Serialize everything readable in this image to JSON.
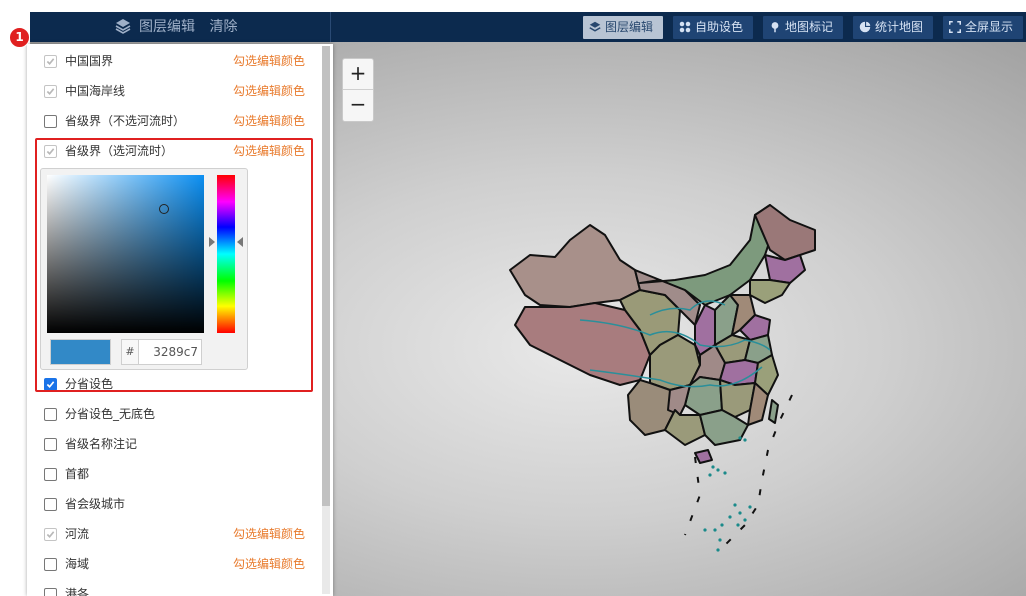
{
  "toolbar": {
    "left_title": "图层编辑",
    "clear_label": "清除",
    "buttons": [
      {
        "label": "图层编辑",
        "icon": "layers-icon",
        "active": true
      },
      {
        "label": "自助设色",
        "icon": "grid-icon",
        "active": false
      },
      {
        "label": "地图标记",
        "icon": "pin-icon",
        "active": false
      },
      {
        "label": "统计地图",
        "icon": "pie-chart-icon",
        "active": false
      },
      {
        "label": "全屏显示",
        "icon": "fullscreen-icon",
        "active": false
      }
    ]
  },
  "zoom": {
    "in_label": "+",
    "out_label": "−"
  },
  "badge": "1",
  "layers": [
    {
      "label": "中国国界",
      "checked": true,
      "disabled": true,
      "edit_label": "勾选编辑颜色"
    },
    {
      "label": "中国海岸线",
      "checked": true,
      "disabled": true,
      "edit_label": "勾选编辑颜色"
    },
    {
      "label": "省级界（不选河流时）",
      "checked": false,
      "disabled": false,
      "edit_label": "勾选编辑颜色"
    },
    {
      "label": "省级界（选河流时）",
      "checked": true,
      "disabled": true,
      "edit_label": "勾选编辑颜色"
    },
    {
      "label": "分省设色",
      "checked": true,
      "disabled": false,
      "edit_label": ""
    },
    {
      "label": "分省设色_无底色",
      "checked": false,
      "disabled": false,
      "edit_label": ""
    },
    {
      "label": "省级名称注记",
      "checked": false,
      "disabled": false,
      "edit_label": ""
    },
    {
      "label": "首都",
      "checked": false,
      "disabled": false,
      "edit_label": ""
    },
    {
      "label": "省会级城市",
      "checked": false,
      "disabled": false,
      "edit_label": ""
    },
    {
      "label": "河流",
      "checked": true,
      "disabled": true,
      "edit_label": "勾选编辑颜色"
    },
    {
      "label": "海域",
      "checked": false,
      "disabled": false,
      "edit_label": "勾选编辑颜色"
    },
    {
      "label": "港各",
      "checked": false,
      "disabled": false,
      "edit_label": ""
    }
  ],
  "color_picker": {
    "hash_label": "#",
    "hex_value": "3289c7",
    "swatch_color": "#3289c7"
  },
  "colors": {
    "topbar": "#0c2a4e",
    "button": "#1f4474",
    "accent_orange": "#e87a2c",
    "highlight_red": "#e02020"
  }
}
